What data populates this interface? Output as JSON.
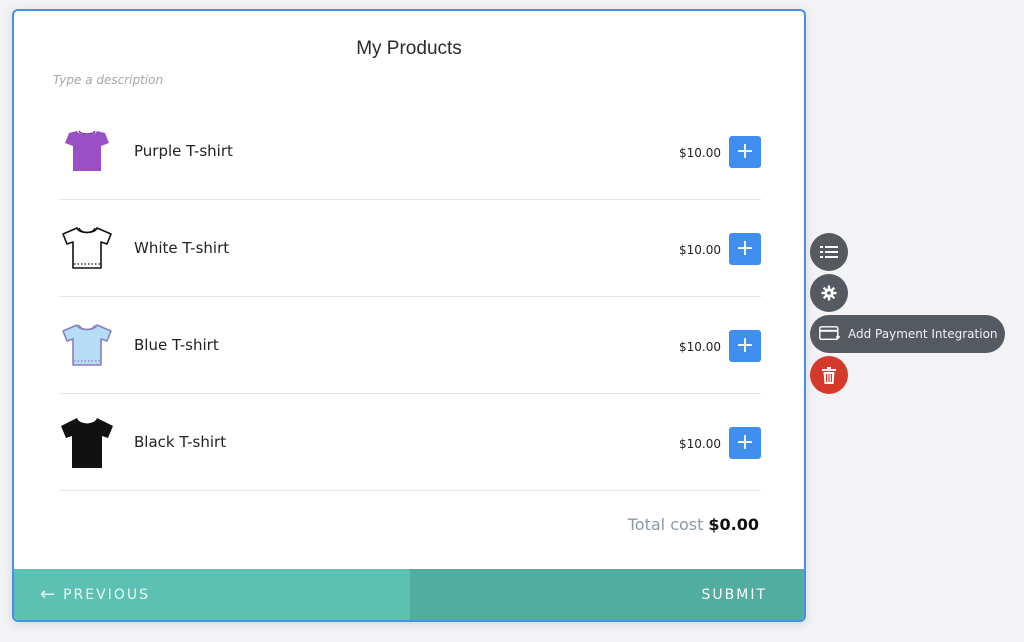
{
  "form": {
    "title": "My Products",
    "description_placeholder": "Type a description"
  },
  "products": [
    {
      "name": "Purple T-shirt",
      "price": "$10.00",
      "color": "#9a4fc4",
      "add_label": "+"
    },
    {
      "name": "White T-shirt",
      "price": "$10.00",
      "color": "#ffffff",
      "add_label": "+"
    },
    {
      "name": "Blue T-shirt",
      "price": "$10.00",
      "color": "#b7dcf5",
      "add_label": "+"
    },
    {
      "name": "Black T-shirt",
      "price": "$10.00",
      "color": "#111111",
      "add_label": "+"
    }
  ],
  "total": {
    "label": "Total cost",
    "value": "$0.00"
  },
  "footer": {
    "previous_arrow": "←",
    "previous_label": "PREVIOUS",
    "submit_label": "SUBMIT"
  },
  "toolbar": {
    "payment_label": "Add Payment Integration",
    "icons": [
      "list-icon",
      "gear-icon",
      "credit-card-icon",
      "trash-icon"
    ]
  },
  "colors": {
    "accent_blue": "#3f8ef0",
    "footer_prev": "#5cc1b3",
    "footer_submit": "#51ad9f",
    "tool_dark": "#555a61",
    "danger": "#d43a2c"
  }
}
